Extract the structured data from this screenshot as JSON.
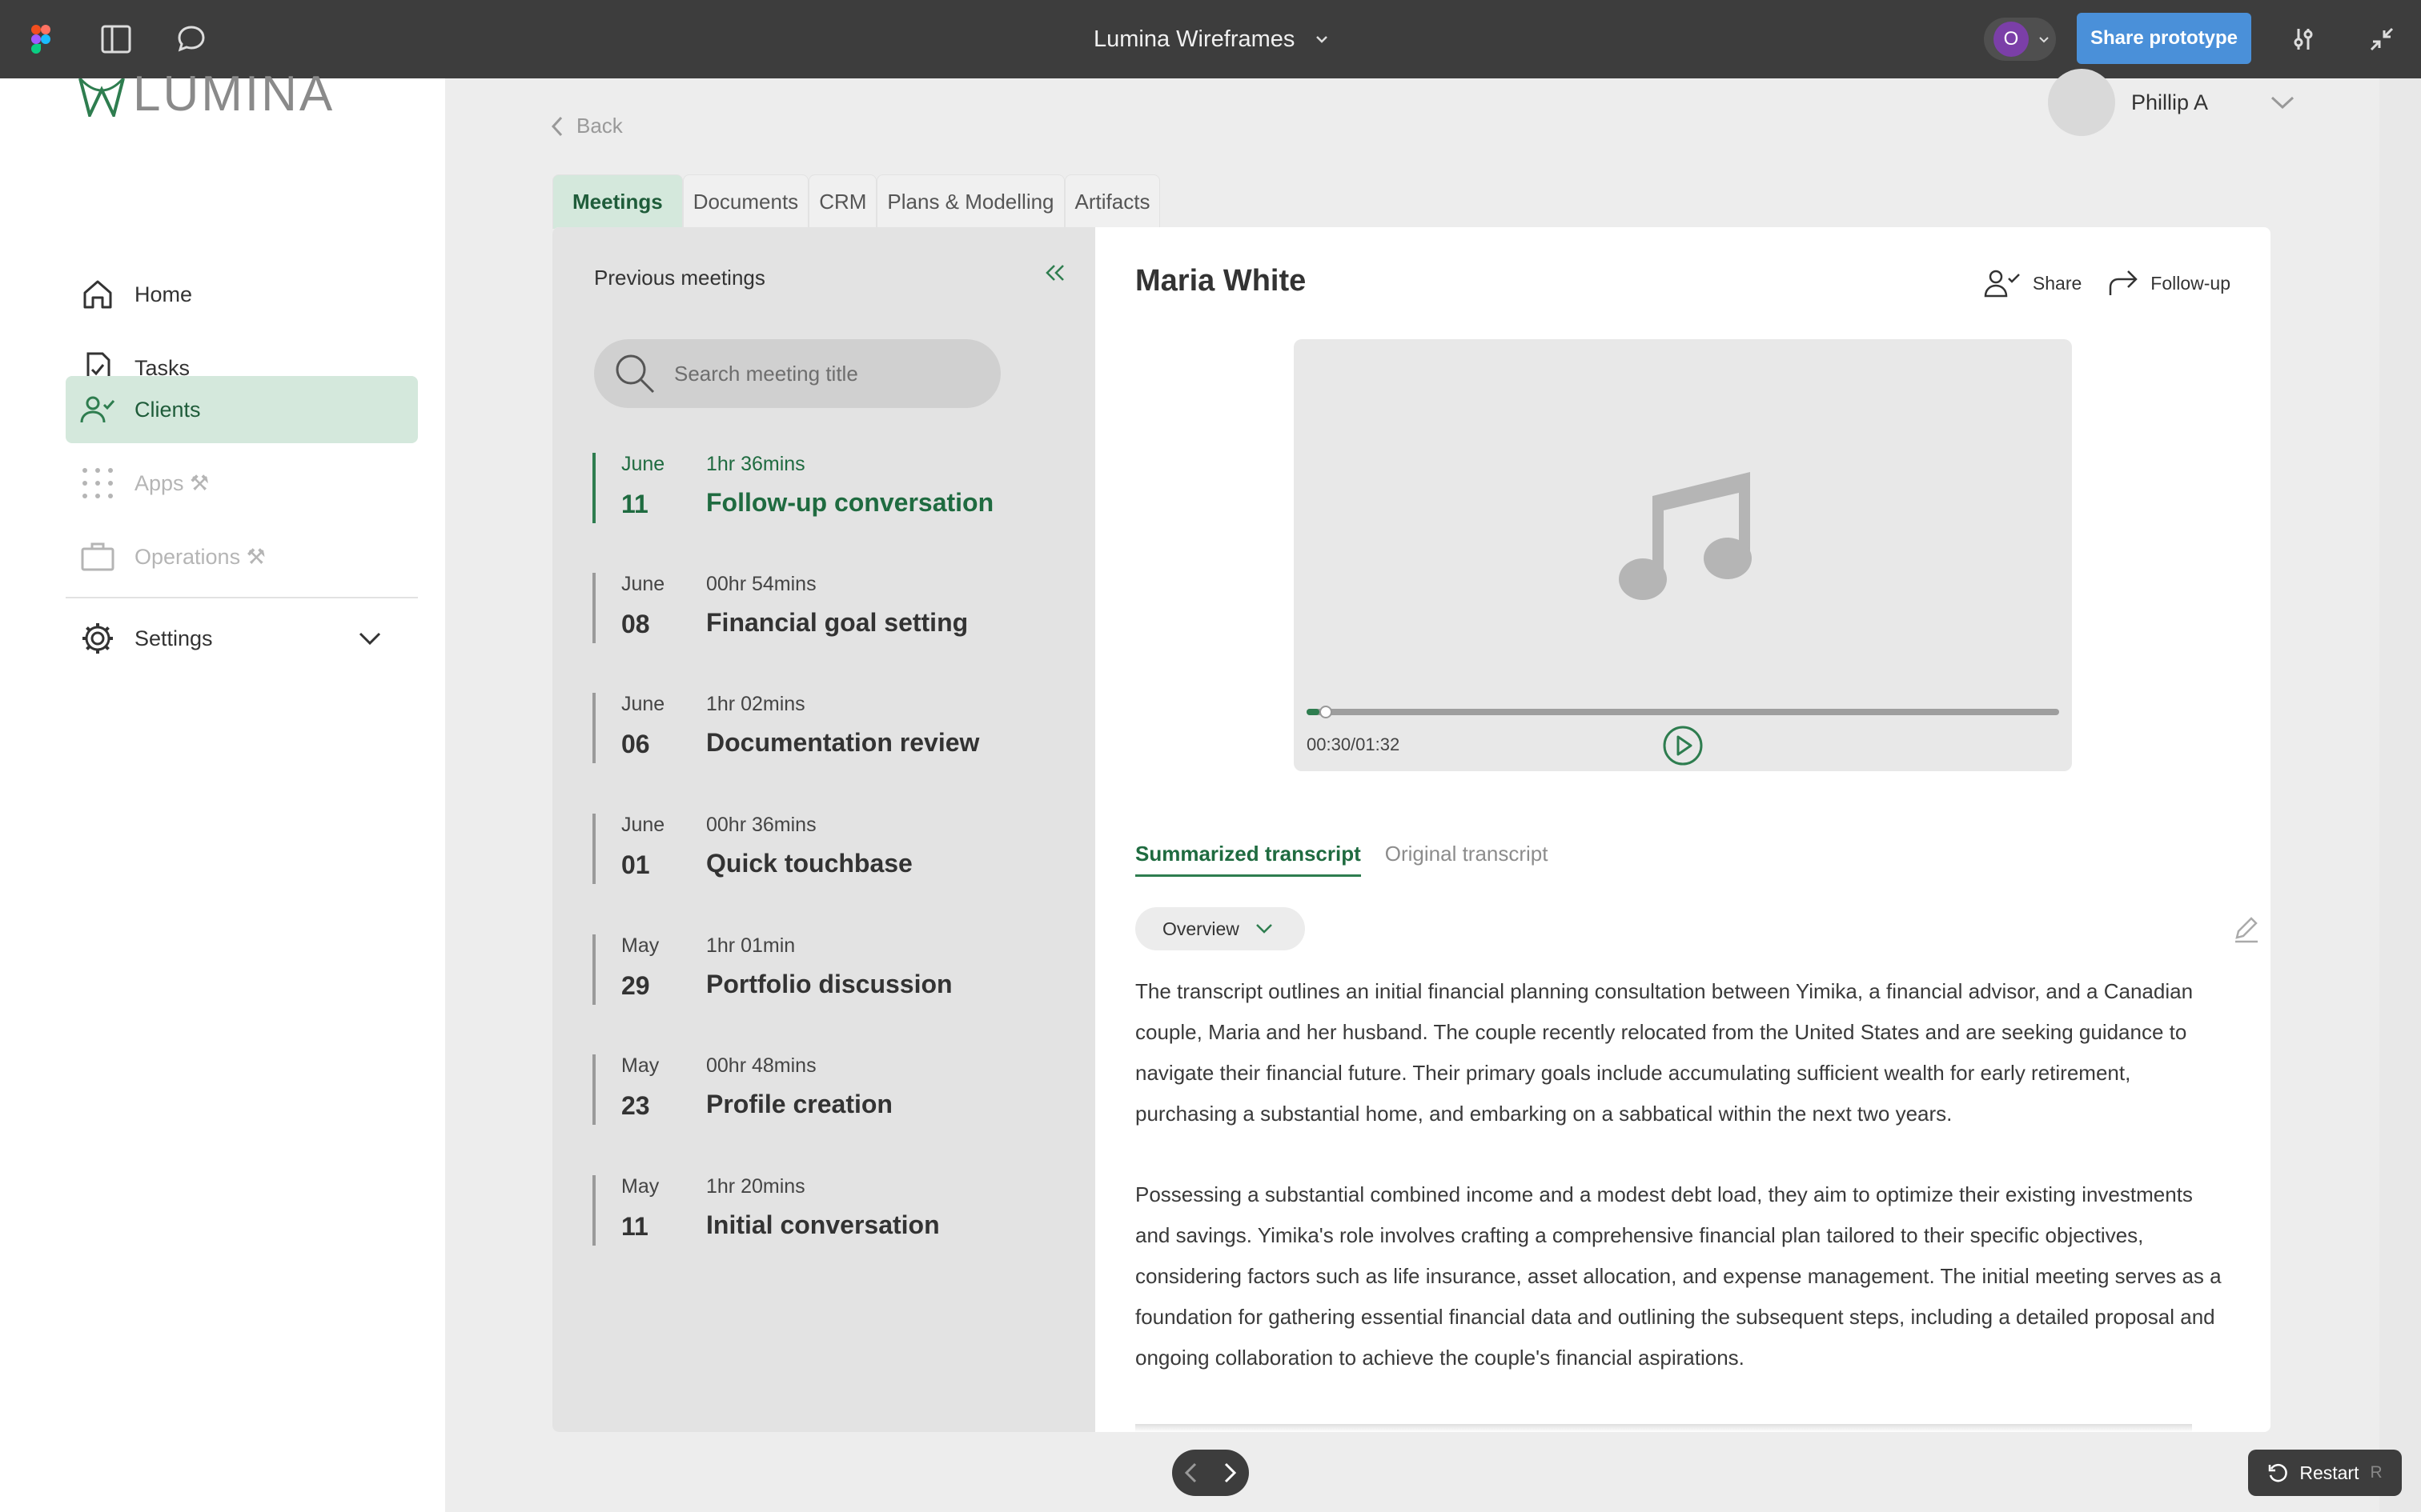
{
  "figma": {
    "file_title": "Lumina Wireframes",
    "avatar_initial": "O",
    "share_label": "Share prototype"
  },
  "brand": {
    "logo_text": "LUMINA",
    "accent": "#2e7d4f",
    "accent_light": "#d4e8dc",
    "figma_bar": "#3d3d3d",
    "share_blue": "#4a90d9"
  },
  "sidebar": {
    "items": [
      {
        "label": "Home",
        "icon": "home-icon",
        "state": "normal"
      },
      {
        "label": "Tasks",
        "icon": "tasks-icon",
        "state": "normal"
      },
      {
        "label": "Clients",
        "icon": "clients-icon",
        "state": "active"
      },
      {
        "label": "Apps ⚒",
        "icon": "apps-grid-icon",
        "state": "disabled"
      },
      {
        "label": "Operations ⚒",
        "icon": "briefcase-icon",
        "state": "disabled"
      },
      {
        "label": "Settings",
        "icon": "gear-icon",
        "state": "normal"
      }
    ]
  },
  "header": {
    "back_label": "Back",
    "user_name": "Phillip A"
  },
  "tabs": [
    {
      "label": "Meetings",
      "active": true
    },
    {
      "label": "Documents",
      "active": false
    },
    {
      "label": "CRM",
      "active": false
    },
    {
      "label": "Plans & Modelling",
      "active": false
    },
    {
      "label": "Artifacts",
      "active": false
    }
  ],
  "meetings": {
    "heading": "Previous meetings",
    "search_placeholder": "Search meeting title",
    "items": [
      {
        "month": "June",
        "day": "11",
        "duration": "1hr 36mins",
        "title": "Follow-up conversation",
        "active": true
      },
      {
        "month": "June",
        "day": "08",
        "duration": "00hr 54mins",
        "title": "Financial goal setting",
        "active": false
      },
      {
        "month": "June",
        "day": "06",
        "duration": "1hr 02mins",
        "title": "Documentation review",
        "active": false
      },
      {
        "month": "June",
        "day": "01",
        "duration": "00hr 36mins",
        "title": "Quick touchbase",
        "active": false
      },
      {
        "month": "May",
        "day": "29",
        "duration": "1hr 01min",
        "title": "Portfolio discussion",
        "active": false
      },
      {
        "month": "May",
        "day": "23",
        "duration": "00hr 48mins",
        "title": "Profile creation",
        "active": false
      },
      {
        "month": "May",
        "day": "11",
        "duration": "1hr 20mins",
        "title": "Initial conversation",
        "active": false
      }
    ]
  },
  "detail": {
    "client_name": "Maria White",
    "share_label": "Share",
    "followup_label": "Follow-up",
    "player": {
      "time_display": "00:30/01:32",
      "progress_fraction": 0.017
    },
    "transcript_tabs": [
      {
        "label": "Summarized transcript",
        "active": true
      },
      {
        "label": "Original transcript",
        "active": false
      }
    ],
    "section_select": "Overview",
    "paragraphs": [
      "The transcript outlines an initial financial planning consultation between Yimika, a financial advisor, and a Canadian couple, Maria and her husband. The couple recently relocated from the United States and are seeking guidance to navigate their financial future. Their primary goals include accumulating sufficient wealth for early retirement, purchasing a substantial home, and embarking on a sabbatical within the next two years.",
      "Possessing a substantial combined income and a modest debt load, they aim to optimize their existing investments and savings. Yimika's role involves crafting a comprehensive financial plan tailored to their specific objectives, considering factors such as life insurance, asset allocation, and expense management. The initial meeting serves as a foundation for gathering essential financial data and outlining the subsequent steps, including a detailed proposal and ongoing collaboration to achieve the couple's financial aspirations."
    ]
  },
  "prototype_controls": {
    "restart_label": "Restart",
    "restart_key": "R"
  }
}
